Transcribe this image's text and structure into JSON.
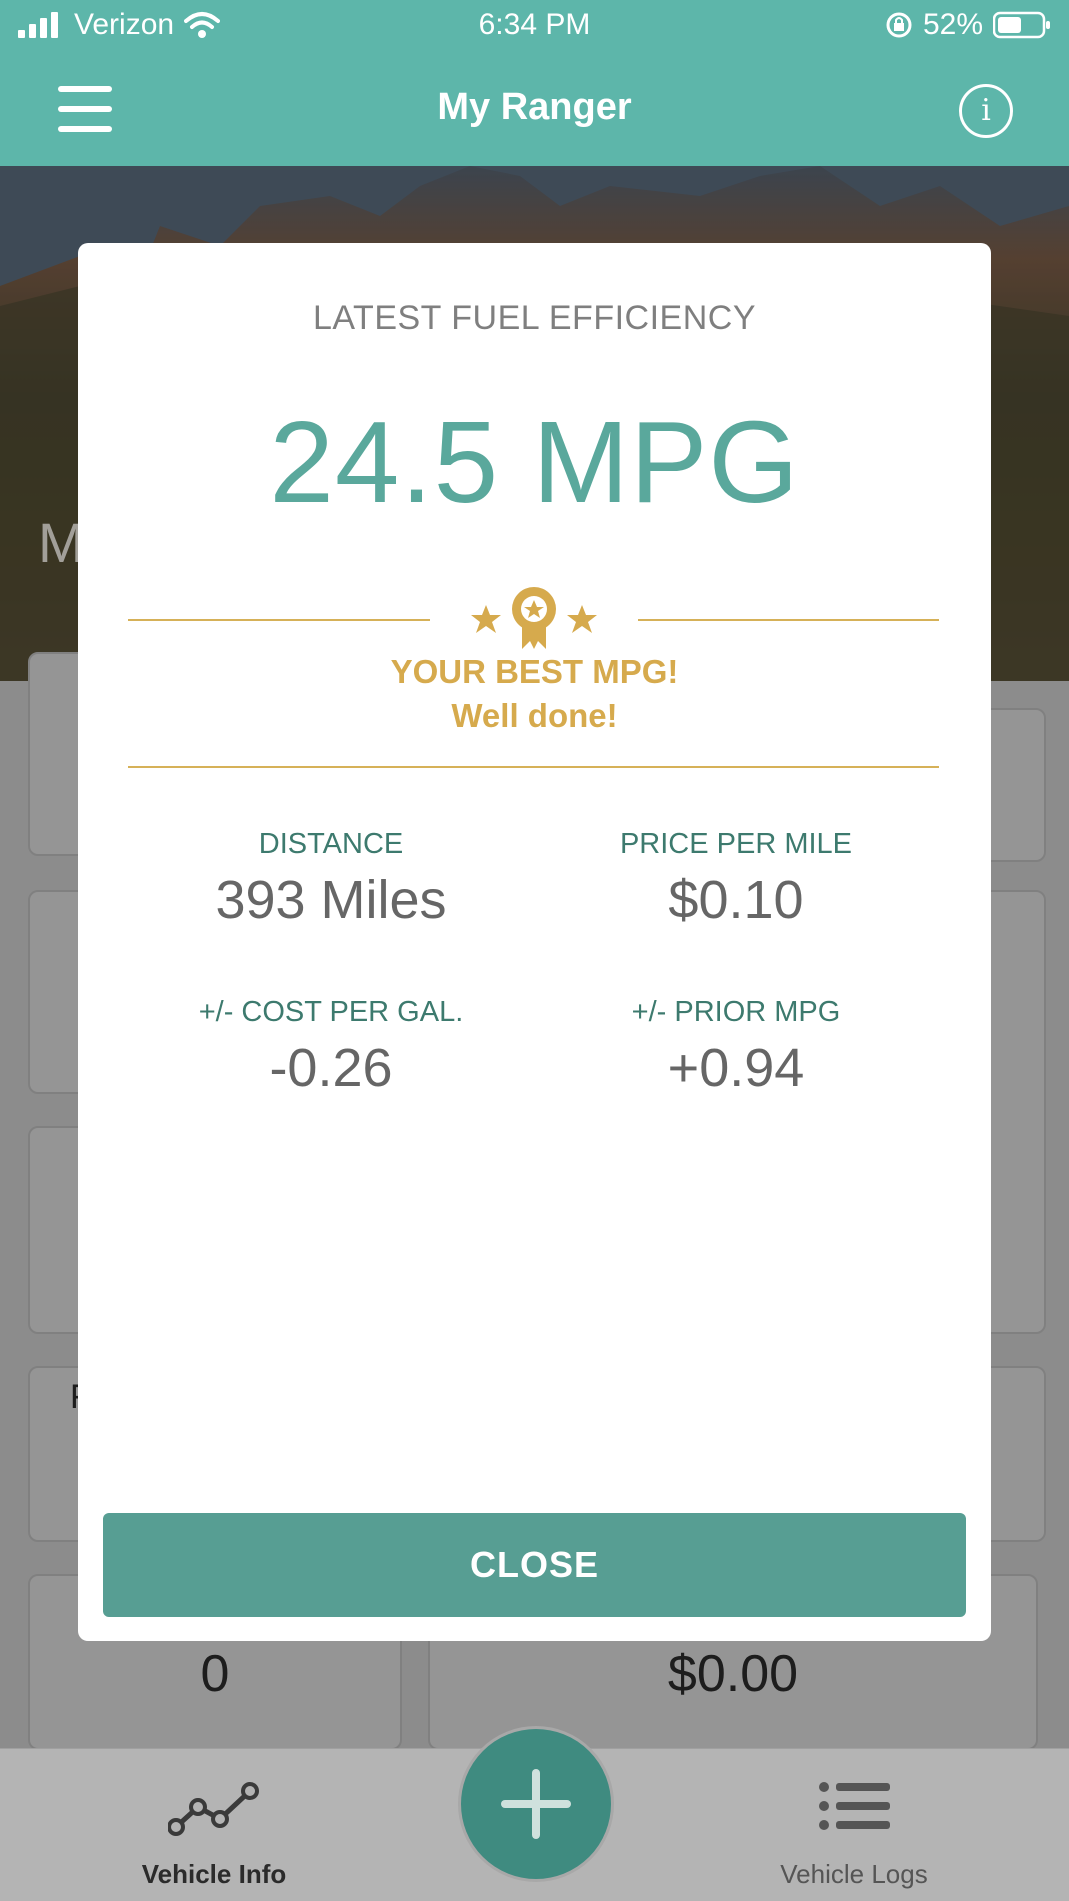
{
  "status_bar": {
    "carrier": "Verizon",
    "time": "6:34 PM",
    "battery": "52%"
  },
  "navbar": {
    "title": "My Ranger"
  },
  "background": {
    "hero_letter": "M",
    "card_letter": "F",
    "card_value_left": "0",
    "card_value_right": "$0.00"
  },
  "modal": {
    "heading": "LATEST FUEL EFFICIENCY",
    "mpg": "24.5 MPG",
    "best_title": "YOUR BEST MPG!",
    "best_subtitle": "Well done!",
    "stats": [
      {
        "label": "DISTANCE",
        "value": "393 Miles"
      },
      {
        "label": "PRICE PER MILE",
        "value": "$0.10"
      },
      {
        "label": "+/- COST PER GAL.",
        "value": "-0.26"
      },
      {
        "label": "+/- PRIOR MPG",
        "value": "+0.94"
      }
    ],
    "close_label": "CLOSE"
  },
  "tabbar": {
    "vehicle_info": "Vehicle Info",
    "vehicle_logs": "Vehicle Logs"
  },
  "colors": {
    "brand_teal": "#5db6aa",
    "mpg_teal": "#5aa89c",
    "gold": "#d6aa4d",
    "button_teal": "#579e93"
  }
}
